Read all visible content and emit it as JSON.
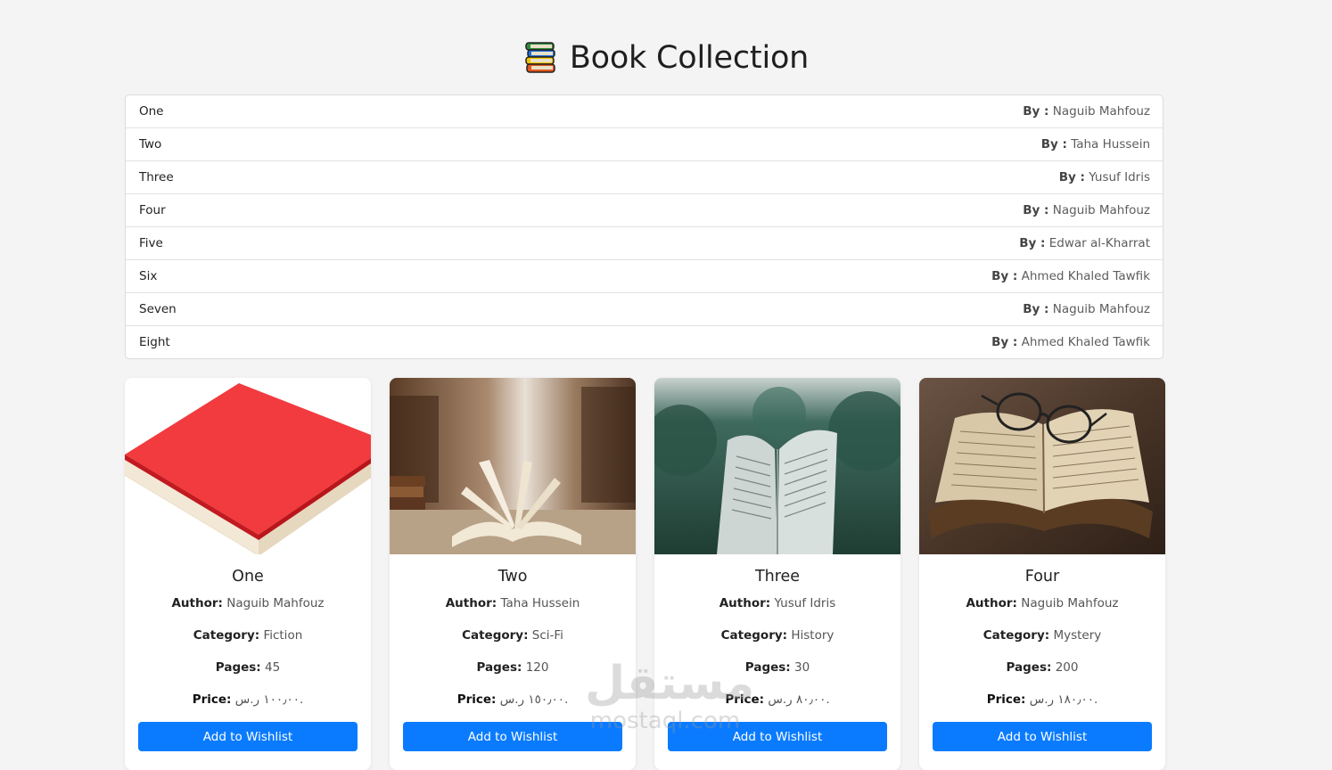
{
  "header": {
    "title": "Book Collection",
    "icon": "books-stack-icon"
  },
  "book_list": [
    {
      "title": "One",
      "by_label": "By :",
      "author": "Naguib Mahfouz"
    },
    {
      "title": "Two",
      "by_label": "By :",
      "author": "Taha Hussein"
    },
    {
      "title": "Three",
      "by_label": "By :",
      "author": "Yusuf Idris"
    },
    {
      "title": "Four",
      "by_label": "By :",
      "author": "Naguib Mahfouz"
    },
    {
      "title": "Five",
      "by_label": "By :",
      "author": "Edwar al-Kharrat"
    },
    {
      "title": "Six",
      "by_label": "By :",
      "author": "Ahmed Khaled Tawfik"
    },
    {
      "title": "Seven",
      "by_label": "By :",
      "author": "Naguib Mahfouz"
    },
    {
      "title": "Eight",
      "by_label": "By :",
      "author": "Ahmed Khaled Tawfik"
    }
  ],
  "labels": {
    "author": "Author:",
    "category": "Category:",
    "pages": "Pages:",
    "price": "Price:",
    "wishlist_button": "Add to Wishlist"
  },
  "cards": [
    {
      "title": "One",
      "author": "Naguib Mahfouz",
      "category": "Fiction",
      "pages": "45",
      "price": "١٠٠٫٠٠ ر.س.",
      "image": "red-book-photo"
    },
    {
      "title": "Two",
      "author": "Taha Hussein",
      "category": "Sci-Fi",
      "pages": "120",
      "price": "١٥٠٫٠٠ ر.س.",
      "image": "open-book-library-photo"
    },
    {
      "title": "Three",
      "author": "Yusuf Idris",
      "category": "History",
      "pages": "30",
      "price": "٨٠٫٠٠ ر.س.",
      "image": "open-book-forest-photo"
    },
    {
      "title": "Four",
      "author": "Naguib Mahfouz",
      "category": "Mystery",
      "pages": "200",
      "price": "١٨٠٫٠٠ ر.س.",
      "image": "open-book-glasses-photo"
    }
  ],
  "watermark": {
    "logo_text": "مستقل",
    "url": "mostaql.com"
  },
  "colors": {
    "accent": "#0a7bff",
    "background": "#f4f4f4"
  }
}
